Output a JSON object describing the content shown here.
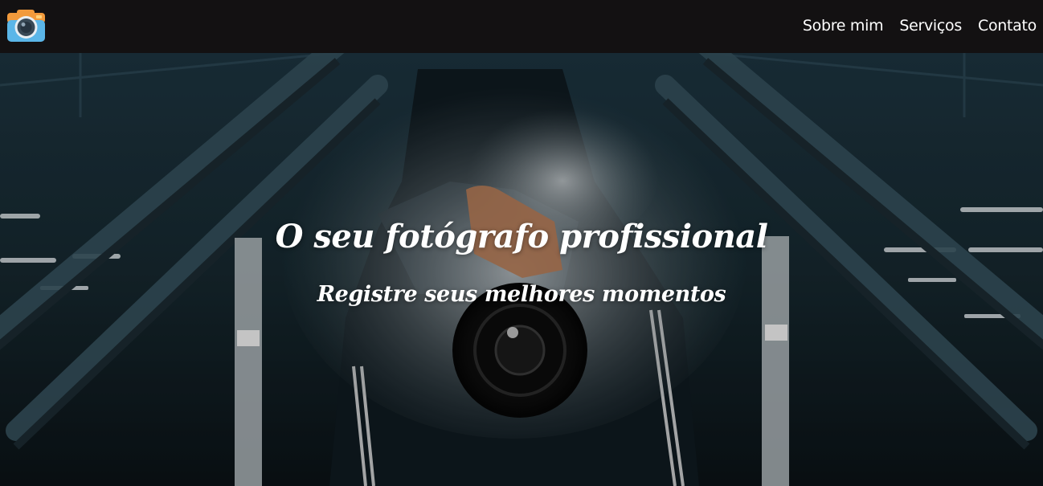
{
  "nav": {
    "logo_icon": "camera-icon",
    "links": [
      "Sobre mim",
      "Serviços",
      "Contato"
    ]
  },
  "hero": {
    "title": "O seu fotógrafo profissional",
    "subtitle": "Registre seus melhores momentos",
    "background": "photographer-with-camera-on-escalator"
  },
  "colors": {
    "navbar_bg": "#131112",
    "nav_text": "#ffffff",
    "hero_text": "#ffffff",
    "camera_body": "#5bb6e8",
    "camera_top": "#f29a3c"
  }
}
